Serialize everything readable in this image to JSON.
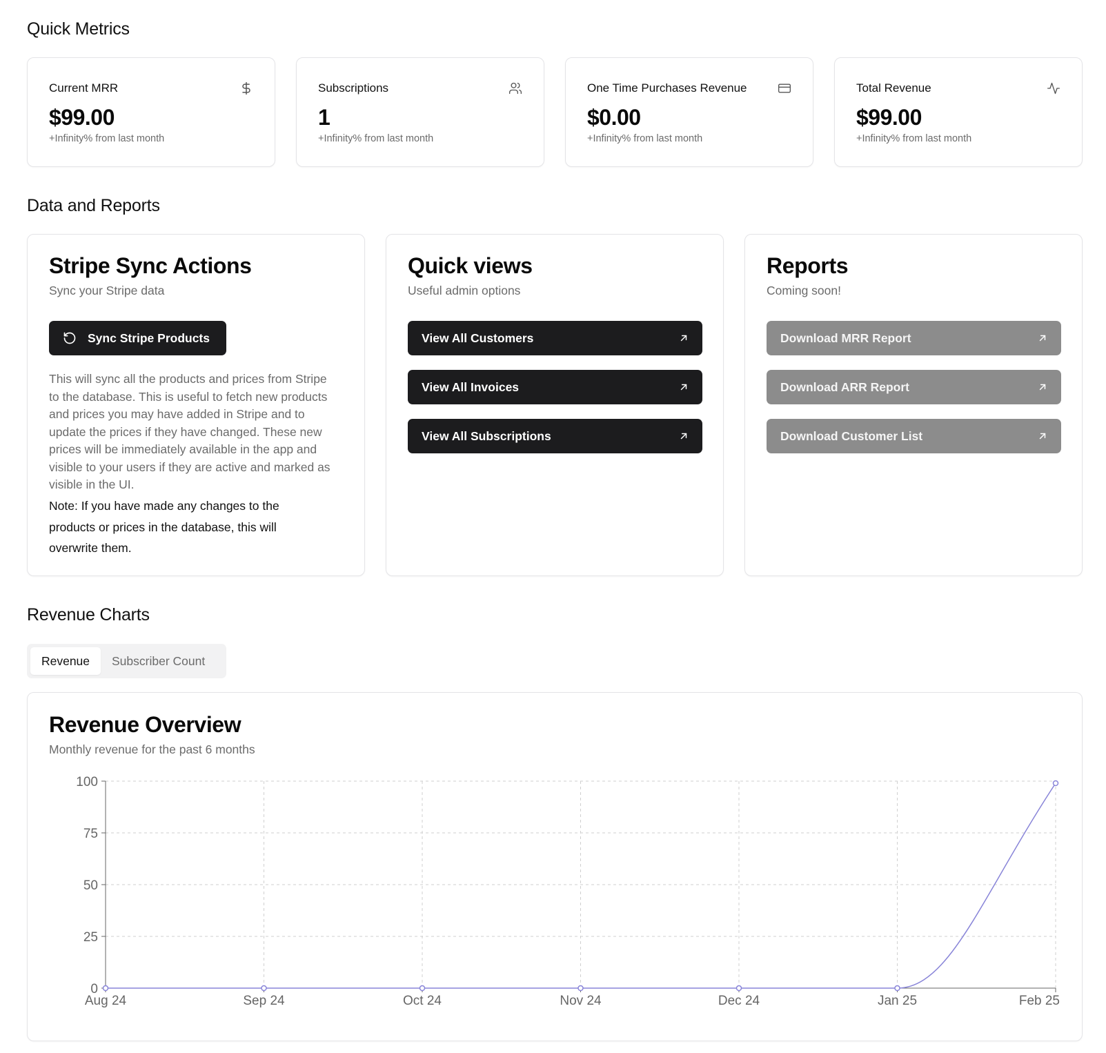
{
  "sections": {
    "metrics_title": "Quick Metrics",
    "data_title": "Data and Reports",
    "charts_title": "Revenue Charts"
  },
  "metrics": [
    {
      "label": "Current MRR",
      "value": "$99.00",
      "sub": "+Infinity% from last month",
      "icon": "dollar-icon"
    },
    {
      "label": "Subscriptions",
      "value": "1",
      "sub": "+Infinity% from last month",
      "icon": "users-icon"
    },
    {
      "label": "One Time Purchases Revenue",
      "value": "$0.00",
      "sub": "+Infinity% from last month",
      "icon": "credit-card-icon"
    },
    {
      "label": "Total Revenue",
      "value": "$99.00",
      "sub": "+Infinity% from last month",
      "icon": "activity-icon"
    }
  ],
  "stripe": {
    "title": "Stripe Sync Actions",
    "subtitle": "Sync your Stripe data",
    "button": "Sync Stripe Products",
    "description": "This will sync all the products and prices from Stripe to the database. This is useful to fetch new products and prices you may have added in Stripe and to update the prices if they have changed. These new prices will be immediately available in the app and visible to your users if they are active and marked as visible in the UI.",
    "note": "Note: If you have made any changes to the products or prices in the database, this will overwrite them."
  },
  "quick_views": {
    "title": "Quick views",
    "subtitle": "Useful admin options",
    "buttons": [
      "View All Customers",
      "View All Invoices",
      "View All Subscriptions"
    ]
  },
  "reports": {
    "title": "Reports",
    "subtitle": "Coming soon!",
    "buttons": [
      "Download MRR Report",
      "Download ARR Report",
      "Download Customer List"
    ]
  },
  "tabs": {
    "active": "Revenue",
    "inactive": "Subscriber Count"
  },
  "chart_card": {
    "title": "Revenue Overview",
    "subtitle": "Monthly revenue for the past 6 months"
  },
  "colors": {
    "primary_button": "#1c1c1e",
    "disabled_button": "#8c8c8c",
    "line": "#8884d8"
  },
  "chart_data": {
    "type": "line",
    "categories": [
      "Aug 24",
      "Sep 24",
      "Oct 24",
      "Nov 24",
      "Dec 24",
      "Jan 25",
      "Feb 25"
    ],
    "series": [
      {
        "values": [
          0,
          0,
          0,
          0,
          0,
          0,
          99
        ]
      }
    ],
    "ylim": [
      0,
      100
    ],
    "yticks": [
      "0",
      "25",
      "50",
      "75",
      "100"
    ],
    "grid": true,
    "xlabel": "",
    "ylabel": ""
  }
}
